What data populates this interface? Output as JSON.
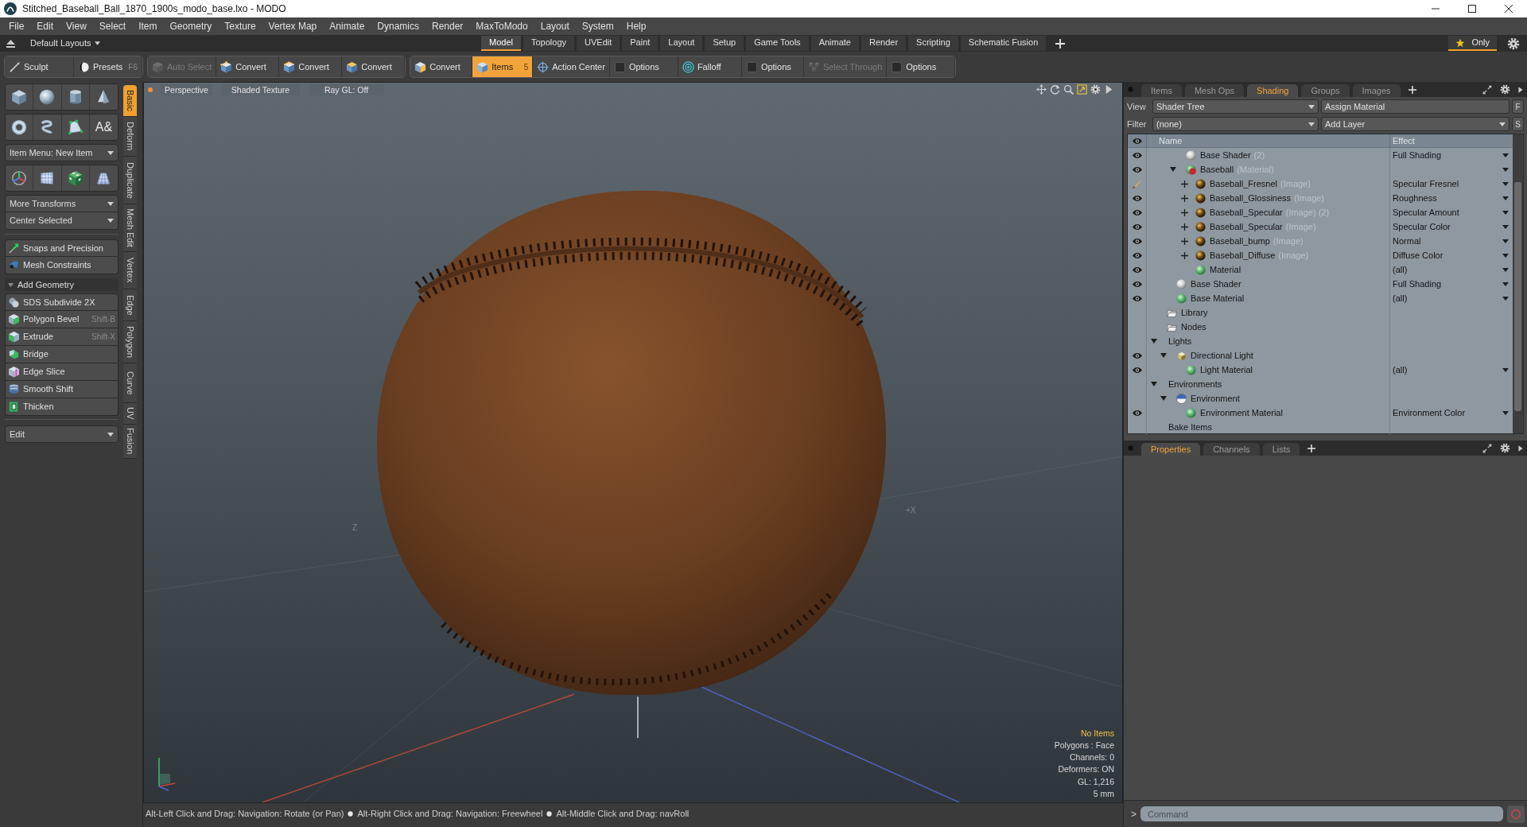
{
  "window": {
    "title": "Stitched_Baseball_Ball_1870_1900s_modo_base.lxo - MODO"
  },
  "menu": [
    "File",
    "Edit",
    "View",
    "Select",
    "Item",
    "Geometry",
    "Texture",
    "Vertex Map",
    "Animate",
    "Dynamics",
    "Render",
    "MaxToModo",
    "Layout",
    "System",
    "Help"
  ],
  "layout_bar": {
    "layouts": "Default Layouts",
    "tabs": [
      {
        "label": "Model",
        "selected": true
      },
      {
        "label": "Topology",
        "selected": false
      },
      {
        "label": "UVEdit",
        "selected": false
      },
      {
        "label": "Paint",
        "selected": false
      },
      {
        "label": "Layout",
        "selected": false
      },
      {
        "label": "Setup",
        "selected": false
      },
      {
        "label": "Game Tools",
        "selected": false
      },
      {
        "label": "Animate",
        "selected": false
      },
      {
        "label": "Render",
        "selected": false
      },
      {
        "label": "Scripting",
        "selected": false
      },
      {
        "label": "Schematic Fusion",
        "selected": false
      }
    ],
    "only": "Only"
  },
  "toolbar": {
    "groups": [
      [
        {
          "label": "Sculpt",
          "selected": false,
          "disabled": false
        },
        {
          "label": "Presets",
          "shortcut": "F6",
          "selected": false,
          "disabled": false
        }
      ],
      [
        {
          "label": "Auto Select",
          "selected": false,
          "disabled": true
        },
        {
          "label": "Convert",
          "selected": false,
          "disabled": false
        },
        {
          "label": "Convert",
          "selected": false,
          "disabled": false
        },
        {
          "label": "Convert",
          "selected": false,
          "disabled": false
        }
      ],
      [
        {
          "label": "Convert",
          "selected": false,
          "disabled": false
        },
        {
          "label": "Items",
          "shortcut": "5",
          "selected": true,
          "disabled": false
        },
        {
          "label": "Action Center",
          "selected": false,
          "disabled": false
        },
        {
          "label": "Options",
          "selected": false,
          "disabled": false
        },
        {
          "label": "Falloff",
          "selected": false,
          "disabled": false
        },
        {
          "label": "Options",
          "selected": false,
          "disabled": false
        },
        {
          "label": "Select Through",
          "selected": false,
          "disabled": true
        },
        {
          "label": "Options",
          "selected": false,
          "disabled": false
        }
      ]
    ]
  },
  "tool_panel": {
    "item_menu": "Item Menu: New Item",
    "text_tool": "A&",
    "transforms": [
      "More Transforms",
      "Center Selected"
    ],
    "snapping": [
      "Snaps and Precision",
      "Mesh Constraints"
    ],
    "add_geometry": {
      "title": "Add Geometry",
      "expanded": true,
      "tools": [
        {
          "label": "SDS Subdivide 2X"
        },
        {
          "label": "Polygon Bevel",
          "shortcut": "Shift-B"
        },
        {
          "label": "Extrude",
          "shortcut": "Shift-X"
        },
        {
          "label": "Bridge"
        },
        {
          "label": "Edge Slice"
        },
        {
          "label": "Smooth Shift"
        },
        {
          "label": "Thicken"
        }
      ]
    },
    "edit_menu": "Edit",
    "side_tabs": [
      {
        "label": "Basic",
        "selected": true
      },
      {
        "label": "Deform",
        "selected": false
      },
      {
        "label": "Duplicate",
        "selected": false
      },
      {
        "label": "Mesh Edit",
        "selected": false
      },
      {
        "label": "Vertex",
        "selected": false
      },
      {
        "label": "Edge",
        "selected": false
      },
      {
        "label": "Polygon",
        "selected": false
      },
      {
        "label": "Curve",
        "selected": false
      },
      {
        "label": "UV",
        "selected": false
      },
      {
        "label": "Fusion",
        "selected": false
      }
    ]
  },
  "viewport": {
    "view_buttons": [
      "Perspective",
      "Shaded Texture",
      "Ray GL: Off"
    ],
    "axis_labels": [
      "Z",
      "+X"
    ],
    "info": [
      {
        "text": "No Items",
        "highlighted": true
      },
      {
        "text": "Polygons : Face",
        "highlighted": false
      },
      {
        "text": "Channels: 0",
        "highlighted": false
      },
      {
        "text": "Deformers: ON",
        "highlighted": false
      },
      {
        "text": "GL: 1,216",
        "highlighted": false
      },
      {
        "text": "5 mm",
        "highlighted": false
      }
    ]
  },
  "status_bar": {
    "hints": [
      "Alt-Left Click and Drag: Navigation: Rotate (or Pan)",
      "Alt-Right Click and Drag: Navigation: Freewheel",
      "Alt-Middle Click and Drag: navRoll"
    ]
  },
  "shading_panel": {
    "tabs": [
      {
        "label": "Items",
        "selected": false
      },
      {
        "label": "Mesh Ops",
        "selected": false
      },
      {
        "label": "Shading",
        "selected": true
      },
      {
        "label": "Groups",
        "selected": false
      },
      {
        "label": "Images",
        "selected": false
      }
    ],
    "view_label": "View",
    "view": "Shader Tree",
    "assign": "Assign Material",
    "assign_button": "F",
    "filter_label": "Filter",
    "filter": "(none)",
    "add_layer": "Add Layer",
    "add_layer_button": "S",
    "columns": [
      "Name",
      "Effect"
    ],
    "tree": [
      {
        "children": [
          {
            "children": [
              {
                "name": "Base Shader",
                "note": "(2)",
                "kind": "shader",
                "toggle": {
                  "kind": "eye"
                },
                "effect": "Full Shading",
                "effect_menu": true
              },
              {
                "name": "Baseball",
                "note": "(Material)",
                "kind": "mask",
                "toggle": {
                  "kind": "eye"
                },
                "effect_menu": true,
                "expanded": true,
                "children": [
                  {
                    "name": "Baseball_Fresnel",
                    "note": "(Image)",
                    "kind": "image",
                    "toggle": {
                      "kind": "brush"
                    },
                    "effect": "Specular Fresnel",
                    "effect_menu": true,
                    "expanded": false
                  },
                  {
                    "name": "Baseball_Glossiness",
                    "note": "(Image)",
                    "kind": "image",
                    "toggle": {
                      "kind": "eye"
                    },
                    "effect": "Roughness",
                    "effect_menu": true,
                    "expanded": false
                  },
                  {
                    "name": "Baseball_Specular",
                    "note": "(Image) (2)",
                    "kind": "image",
                    "toggle": {
                      "kind": "eye"
                    },
                    "effect": "Specular Amount",
                    "effect_menu": true,
                    "expanded": false
                  },
                  {
                    "name": "Baseball_Specular",
                    "note": "(Image)",
                    "kind": "image",
                    "toggle": {
                      "kind": "eye"
                    },
                    "effect": "Specular Color",
                    "effect_menu": true,
                    "expanded": false
                  },
                  {
                    "name": "Baseball_bump",
                    "note": "(Image)",
                    "kind": "image",
                    "toggle": {
                      "kind": "eye"
                    },
                    "effect": "Normal",
                    "effect_menu": true,
                    "expanded": false
                  },
                  {
                    "name": "Baseball_Diffuse",
                    "note": "(Image)",
                    "kind": "image",
                    "toggle": {
                      "kind": "eye"
                    },
                    "effect": "Diffuse Color",
                    "effect_menu": true,
                    "expanded": false
                  },
                  {
                    "name": "Material",
                    "kind": "material",
                    "toggle": {
                      "kind": "eye"
                    },
                    "effect": "(all)",
                    "effect_menu": true
                  }
                ]
              }
            ]
          },
          {
            "name": "Base Shader",
            "kind": "shader",
            "toggle": {
              "kind": "eye"
            },
            "effect": "Full Shading",
            "effect_menu": true
          },
          {
            "name": "Base Material",
            "kind": "material",
            "toggle": {
              "kind": "eye"
            },
            "effect": "(all)",
            "effect_menu": true
          }
        ]
      },
      {
        "name": "Library",
        "kind": "folder",
        "effect_menu": false
      },
      {
        "name": "Nodes",
        "kind": "folder",
        "effect_menu": false
      },
      {
        "name": "Lights",
        "kind": "group",
        "expanded": true,
        "effect_menu": false,
        "children": [
          {
            "name": "Directional Light",
            "kind": "light",
            "toggle": {
              "kind": "eye"
            },
            "expanded": true,
            "effect_menu": false,
            "children": [
              {
                "name": "Light Material",
                "kind": "material",
                "toggle": {
                  "kind": "eye"
                },
                "effect": "(all)",
                "effect_menu": true
              }
            ]
          }
        ]
      },
      {
        "name": "Environments",
        "kind": "group",
        "expanded": true,
        "effect_menu": false,
        "children": [
          {
            "name": "Environment",
            "kind": "environment",
            "expanded": true,
            "effect_menu": false,
            "children": [
              {
                "name": "Environment Material",
                "kind": "material",
                "toggle": {
                  "kind": "eye"
                },
                "effect": "Environment Color",
                "effect_menu": true
              }
            ]
          }
        ]
      },
      {
        "name": "Bake Items",
        "kind": "group",
        "effect_menu": false
      }
    ]
  },
  "properties_panel": {
    "tabs": [
      {
        "label": "Properties",
        "selected": true
      },
      {
        "label": "Channels",
        "selected": false
      },
      {
        "label": "Lists",
        "selected": false
      }
    ]
  },
  "command_line": {
    "prompt": ">",
    "placeholder": "Command"
  }
}
